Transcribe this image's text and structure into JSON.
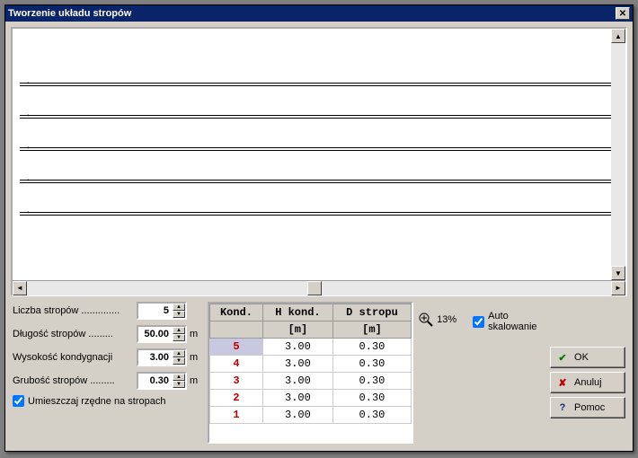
{
  "titlebar": {
    "title": "Tworzenie układu stropów"
  },
  "params": {
    "stories_label": "Liczba stropów ..............",
    "stories_value": "5",
    "length_label": "Długość stropów .........",
    "length_value": "50.00",
    "height_label": "Wysokość kondygnacji",
    "height_value": "3.00",
    "thickness_label": "Grubość stropów .........",
    "thickness_value": "0.30",
    "unit_m": "m",
    "place_ordinates_label": "Umieszczaj rzędne na stropach"
  },
  "table": {
    "head": {
      "kond": "Kond.",
      "hkond": "H kond.",
      "dstropu": "D stropu"
    },
    "sub": {
      "kond": "",
      "hkond": "[m]",
      "dstropu": "[m]"
    },
    "rows": [
      {
        "kond": "5",
        "h": "3.00",
        "d": "0.30"
      },
      {
        "kond": "4",
        "h": "3.00",
        "d": "0.30"
      },
      {
        "kond": "3",
        "h": "3.00",
        "d": "0.30"
      },
      {
        "kond": "2",
        "h": "3.00",
        "d": "0.30"
      },
      {
        "kond": "1",
        "h": "3.00",
        "d": "0.30"
      }
    ]
  },
  "zoom": {
    "value": "13%",
    "autoscale_label": "Auto skalowanie"
  },
  "buttons": {
    "ok": "OK",
    "cancel": "Anuluj",
    "help": "Pomoc"
  }
}
